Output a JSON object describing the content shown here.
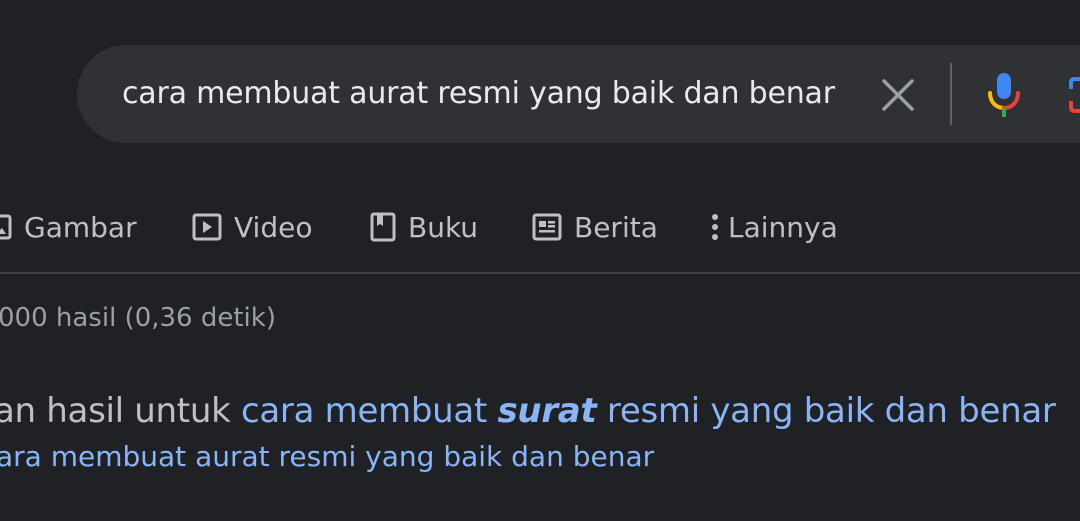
{
  "search": {
    "query": "cara membuat aurat resmi yang baik dan benar"
  },
  "tabs": [
    {
      "label": "Gambar",
      "icon": "image-icon"
    },
    {
      "label": "Video",
      "icon": "play-icon"
    },
    {
      "label": "Buku",
      "icon": "book-icon"
    },
    {
      "label": "Berita",
      "icon": "news-icon"
    },
    {
      "label": "Lainnya",
      "icon": "more-vert-icon"
    }
  ],
  "results": {
    "stats": "000 hasil (0,36 detik)",
    "showing_prefix": "an hasil untuk ",
    "correction_before": "cara membuat ",
    "correction_bold": "surat",
    "correction_after": " resmi yang baik dan benar",
    "search_instead": "ara membuat aurat resmi yang baik dan benar"
  },
  "colors": {
    "background": "#202124",
    "search_bar": "#303134",
    "link": "#8ab4f8",
    "text": "#bdc1c6"
  }
}
